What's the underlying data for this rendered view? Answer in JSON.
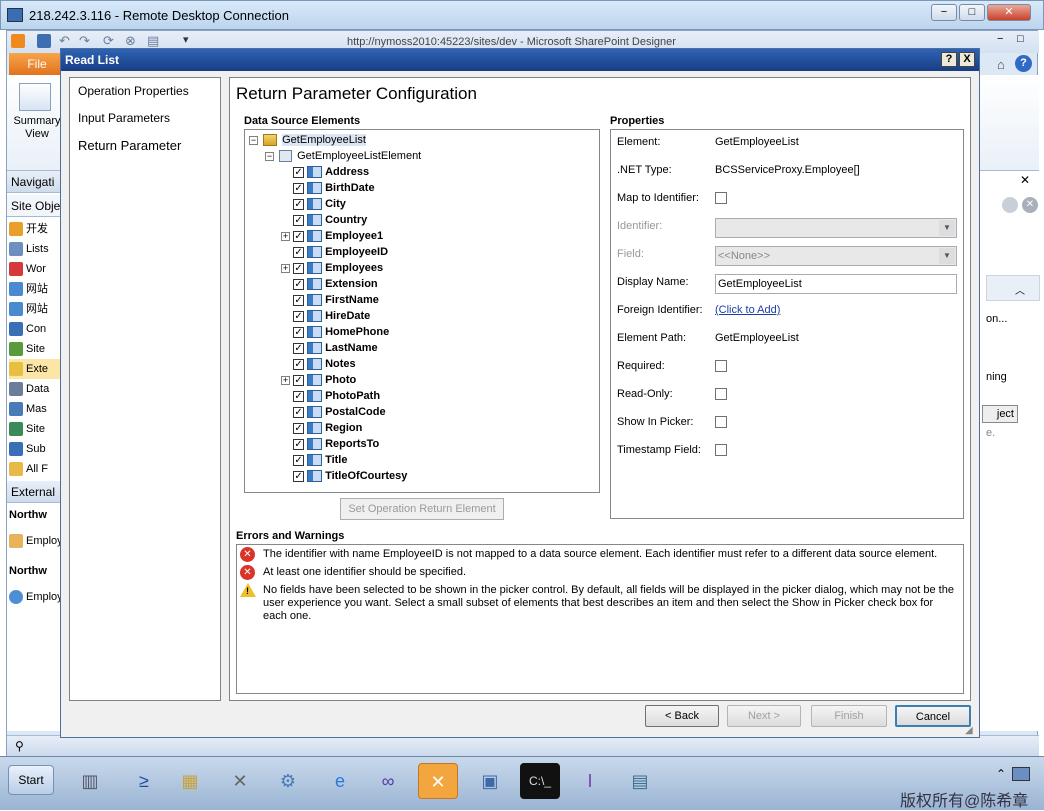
{
  "rdc": {
    "title": "218.242.3.116 - Remote Desktop Connection",
    "min": "−",
    "max": "□",
    "close": "✕"
  },
  "spd": {
    "window_title": "http://nymoss2010:45223/sites/dev - Microsoft SharePoint Designer",
    "file_tab": "File",
    "ribbon_summary": "Summary View",
    "nav_header": "Navigati",
    "site_objects": "Site Obje",
    "nav_items": [
      "开发",
      "Lists",
      "Wor",
      "网站",
      "网站",
      "Con",
      "Site",
      "Exte",
      "Data",
      "Mas",
      "Site",
      "Sub",
      "All F"
    ],
    "external": "External",
    "northw1": "Northw",
    "employ1": "Employ",
    "northw2": "Northw",
    "employ2": "Employ",
    "right_fragments": [
      "on...",
      "ning",
      "ject",
      "e."
    ]
  },
  "dialog": {
    "title": "Read List",
    "help": "?",
    "close": "X",
    "left_nav": [
      "Operation Properties",
      "Input Parameters",
      "Return Parameter"
    ],
    "heading": "Return Parameter Configuration",
    "data_source_label": "Data Source Elements",
    "tree_root": "GetEmployeeList",
    "tree_element": "GetEmployeeListElement",
    "fields": [
      {
        "name": "Address",
        "expand": false
      },
      {
        "name": "BirthDate",
        "expand": false
      },
      {
        "name": "City",
        "expand": false
      },
      {
        "name": "Country",
        "expand": false
      },
      {
        "name": "Employee1",
        "expand": true
      },
      {
        "name": "EmployeeID",
        "expand": false
      },
      {
        "name": "Employees",
        "expand": true
      },
      {
        "name": "Extension",
        "expand": false
      },
      {
        "name": "FirstName",
        "expand": false
      },
      {
        "name": "HireDate",
        "expand": false
      },
      {
        "name": "HomePhone",
        "expand": false
      },
      {
        "name": "LastName",
        "expand": false
      },
      {
        "name": "Notes",
        "expand": false
      },
      {
        "name": "Photo",
        "expand": true
      },
      {
        "name": "PhotoPath",
        "expand": false
      },
      {
        "name": "PostalCode",
        "expand": false
      },
      {
        "name": "Region",
        "expand": false
      },
      {
        "name": "ReportsTo",
        "expand": false
      },
      {
        "name": "Title",
        "expand": false
      },
      {
        "name": "TitleOfCourtesy",
        "expand": false
      }
    ],
    "set_button": "Set Operation Return Element",
    "properties_label": "Properties",
    "props": {
      "element_label": "Element:",
      "element_value": "GetEmployeeList",
      "nettype_label": ".NET Type:",
      "nettype_value": "BCSServiceProxy.Employee[]",
      "map_label": "Map to Identifier:",
      "identifier_label": "Identifier:",
      "field_label": "Field:",
      "field_value": "<<None>>",
      "display_label": "Display Name:",
      "display_value": "GetEmployeeList",
      "foreign_label": "Foreign Identifier:",
      "foreign_link": "(Click to Add)",
      "path_label": "Element Path:",
      "path_value": "GetEmployeeList",
      "required_label": "Required:",
      "readonly_label": "Read-Only:",
      "picker_label": "Show In Picker:",
      "timestamp_label": "Timestamp Field:"
    },
    "errors_label": "Errors and Warnings",
    "errors": [
      {
        "type": "error",
        "text": "The identifier with name EmployeeID is not mapped to a data source element. Each identifier must refer to a different data source element."
      },
      {
        "type": "error",
        "text": "At least one identifier should be specified."
      },
      {
        "type": "warning",
        "text": "No fields have been selected to be shown in the picker control. By default, all fields will be displayed in the picker dialog, which may not be the user experience you want. Select a small subset of elements that best describes an item and then select the Show in Picker check box for each one."
      }
    ],
    "buttons": {
      "back": "< Back",
      "next": "Next >",
      "finish": "Finish",
      "cancel": "Cancel"
    }
  },
  "taskbar": {
    "start": "Start",
    "tray_text": "版权所有@陈希章"
  }
}
